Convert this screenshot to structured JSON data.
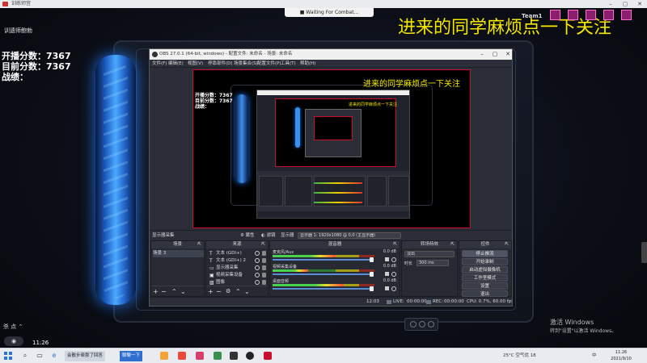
{
  "game_window": {
    "title": "训练师宫",
    "toast": "Waiting For Combat...",
    "top_left_label": "训遗师鲍勃",
    "score_lines": [
      "开播分数：7367",
      "目前分数：7367",
      "战绩："
    ],
    "banner": "进来的同学麻烦点一下关注",
    "team_label": "Team1",
    "kill_label": "杀 点 ⌃",
    "time": "11:26",
    "mic_label": "◉",
    "activate_title": "激活 Windows",
    "activate_sub": "转到\"设置\"以激活 Windows。",
    "accent_color": "#f5e700"
  },
  "obs": {
    "title": "OBS 27.0.1 (64-bit, windows) - 配置文件: 未命名 - 场景: 未命名",
    "menu": [
      "文件(F)",
      "编辑(E)",
      "视图(V)",
      "停靠部件(D)",
      "场景集合(S)",
      "配置文件(P)",
      "工具(T)",
      "帮助(H)"
    ],
    "preview_banner": "进来的同学麻烦点一下关注",
    "preview_scores": [
      "开播分数：7367",
      "目前分数：7367",
      "战绩："
    ],
    "toolbar": {
      "source_name": "显示器采集",
      "properties": "⚙ 属性",
      "filters": "◐ 滤镜",
      "display_label": "显示器",
      "display_value": "显示器 1: 1920x1080 @ 0,0 (主显示器)"
    },
    "scenes": {
      "header": "场景",
      "items": [
        "场景 3"
      ]
    },
    "sources": {
      "header": "来源",
      "items": [
        {
          "icon": "T",
          "label": "文本 (GDI+)"
        },
        {
          "icon": "T",
          "label": "文本 (GDI+) 2"
        },
        {
          "icon": "▭",
          "label": "显示器采集"
        },
        {
          "icon": "▣",
          "label": "视频采集设备"
        },
        {
          "icon": "▨",
          "label": "图像"
        }
      ]
    },
    "mixer": {
      "header": "混音器",
      "channels": [
        {
          "name": "麦克风/Aux",
          "db": "0.0 dB",
          "level": 0.62
        },
        {
          "name": "视频采集设备",
          "db": "0.0 dB",
          "level": 0.35
        },
        {
          "name": "桌面音频",
          "db": "0.0 dB",
          "level": 0.7
        }
      ]
    },
    "transitions": {
      "header": "转场特效",
      "selected": "淡出",
      "duration_label": "时长",
      "duration_value": "300 ms"
    },
    "controls": {
      "header": "控件",
      "buttons": [
        "停止推流",
        "开始录制",
        "启动虚拟摄像机",
        "工作室模式",
        "设置",
        "退出"
      ]
    },
    "status": {
      "live_label": "LIVE:",
      "live_time": "00:00:00",
      "rec_label": "REC:",
      "rec_time": "00:00:00",
      "cpu": "CPU: 0.7%, 60.00 fps",
      "dropped": "12:03"
    }
  },
  "taskbar": {
    "search_icon": "search-icon",
    "items": [
      "会散步牵那了回答",
      "聊聊一下"
    ],
    "tray_temp": "25°C 空气优 18",
    "tray_lang": "中",
    "clock_time": "11:26",
    "clock_date": "2021/9/10"
  }
}
